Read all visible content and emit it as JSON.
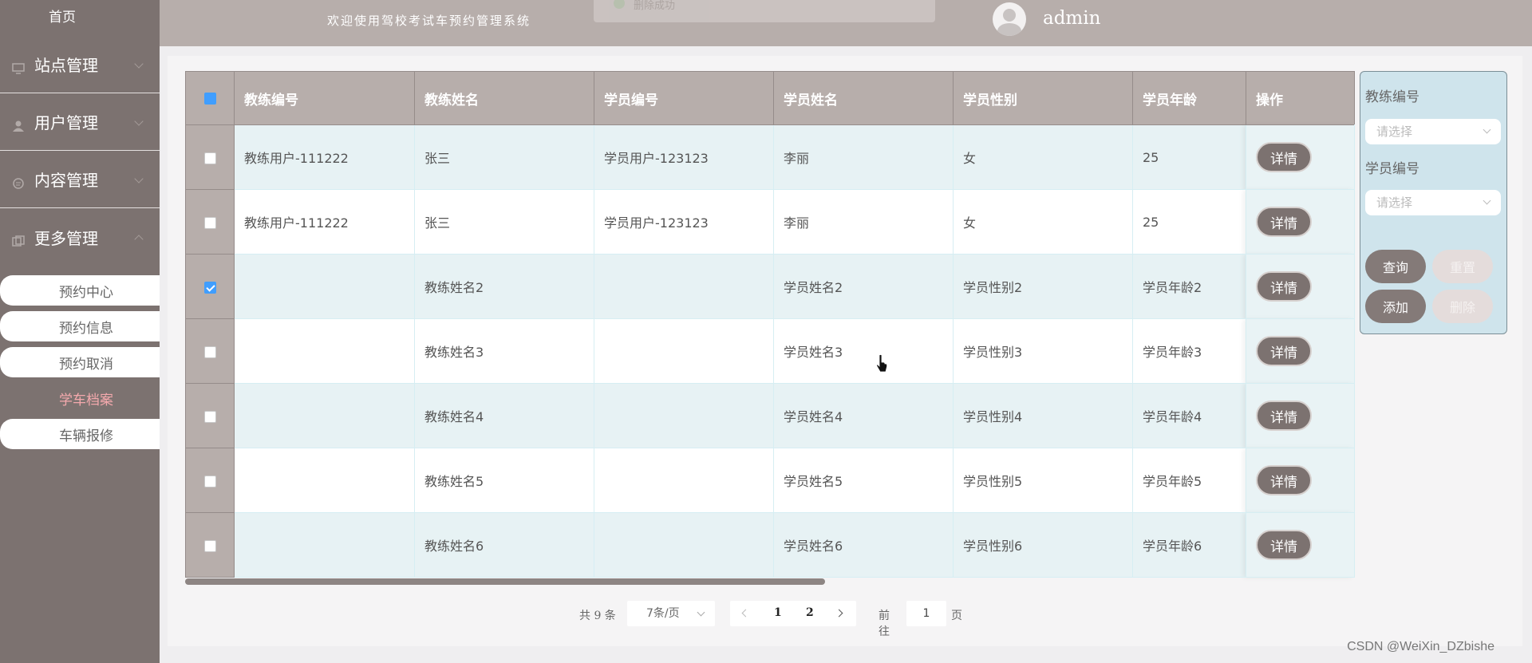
{
  "sidebar": {
    "home": "首页",
    "groups": [
      {
        "label": "站点管理",
        "icon": "monitor-icon"
      },
      {
        "label": "用户管理",
        "icon": "user-icon"
      },
      {
        "label": "内容管理",
        "icon": "message-icon"
      },
      {
        "label": "更多管理",
        "icon": "copy-icon"
      }
    ],
    "sub_items": [
      "预约中心",
      "预约信息",
      "预约取消",
      "学车档案",
      "车辆报修"
    ],
    "active_sub": "学车档案"
  },
  "header": {
    "welcome": "欢迎使用驾校考试车预约管理系统",
    "toast": "删除成功",
    "username": "admin"
  },
  "table": {
    "columns": [
      "教练编号",
      "教练姓名",
      "学员编号",
      "学员姓名",
      "学员性别",
      "学员年龄",
      "操作"
    ],
    "rows": [
      {
        "checked": false,
        "cells": [
          "教练用户-111222",
          "张三",
          "学员用户-123123",
          "李丽",
          "女",
          "25"
        ]
      },
      {
        "checked": false,
        "cells": [
          "教练用户-111222",
          "张三",
          "学员用户-123123",
          "李丽",
          "女",
          "25"
        ]
      },
      {
        "checked": true,
        "cells": [
          "",
          "教练姓名2",
          "",
          "学员姓名2",
          "学员性别2",
          "学员年龄2"
        ]
      },
      {
        "checked": false,
        "cells": [
          "",
          "教练姓名3",
          "",
          "学员姓名3",
          "学员性别3",
          "学员年龄3"
        ]
      },
      {
        "checked": false,
        "cells": [
          "",
          "教练姓名4",
          "",
          "学员姓名4",
          "学员性别4",
          "学员年龄4"
        ]
      },
      {
        "checked": false,
        "cells": [
          "",
          "教练姓名5",
          "",
          "学员姓名5",
          "学员性别5",
          "学员年龄5"
        ]
      },
      {
        "checked": false,
        "cells": [
          "",
          "教练姓名6",
          "",
          "学员姓名6",
          "学员性别6",
          "学员年龄6"
        ]
      }
    ],
    "detail_label": "详情"
  },
  "filter": {
    "coach_label": "教练编号",
    "coach_placeholder": "请选择",
    "student_label": "学员编号",
    "student_placeholder": "请选择",
    "query": "查询",
    "reset": "重置",
    "add": "添加",
    "delete": "删除"
  },
  "pagination": {
    "total": "共 9 条",
    "page_size": "7条/页",
    "pages": [
      "1",
      "2"
    ],
    "goto_label": "前往",
    "goto_value": "1",
    "goto_unit": "页"
  },
  "watermark": "CSDN @WeiXin_DZbishe",
  "colors": {
    "sidebar": "#7c7270",
    "header": "#b7aeab",
    "active_sub": "#f4a9ad",
    "checkbox": "#409eff"
  }
}
